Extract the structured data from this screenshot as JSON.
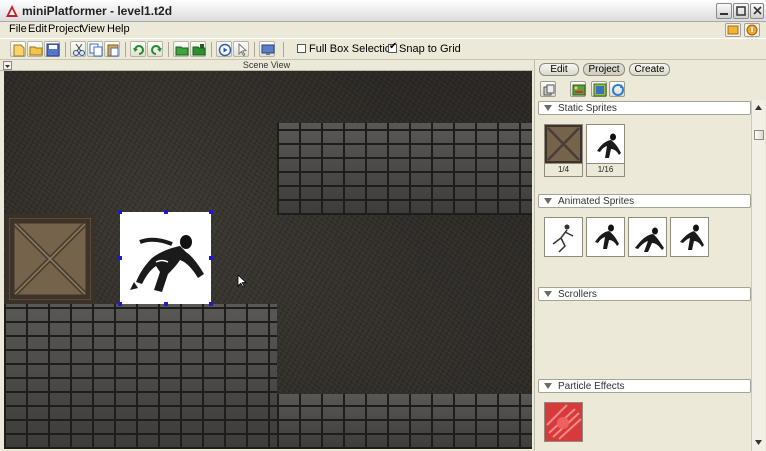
{
  "window": {
    "title": "miniPlatformer - level1.t2d"
  },
  "menu": {
    "items": [
      "File",
      "Edit",
      "Project",
      "View",
      "Help"
    ]
  },
  "toolbar": {
    "buttons": [
      "new-file-icon",
      "open-folder-icon",
      "save-icon",
      "cut-icon",
      "copy-icon",
      "paste-icon",
      "undo-icon",
      "redo-icon",
      "folder-green-icon",
      "folder-green-2-icon",
      "play-icon",
      "pointer-icon",
      "monitor-icon"
    ],
    "full_box_selection": {
      "label": "Full Box Selection",
      "checked": false
    },
    "snap_to_grid": {
      "label": "Snap to Grid",
      "checked": true
    }
  },
  "scene": {
    "title": "Scene View"
  },
  "panel": {
    "tabs": [
      {
        "label": "Edit",
        "active": false
      },
      {
        "label": "Project",
        "active": true
      },
      {
        "label": "Create",
        "active": false
      }
    ],
    "icons": [
      "object-icon",
      "image-map-icon",
      "layer-icon",
      "refresh-icon"
    ],
    "sections": {
      "static": {
        "label": "Static Sprites",
        "items": [
          {
            "caption": "1/4",
            "icon": "crate-sprite"
          },
          {
            "caption": "1/16",
            "icon": "fighter-sprite"
          }
        ]
      },
      "animated": {
        "label": "Animated Sprites",
        "items": [
          "runner-anim",
          "fighter-anim-1",
          "fighter-anim-2",
          "fighter-anim-3"
        ]
      },
      "scrollers": {
        "label": "Scrollers"
      },
      "particles": {
        "label": "Particle Effects",
        "items": [
          "fire-particle"
        ]
      }
    }
  },
  "colors": {
    "accent": "#1c1cc0",
    "chrome": "#ece9d8",
    "scene_bg": "#2b2824"
  }
}
